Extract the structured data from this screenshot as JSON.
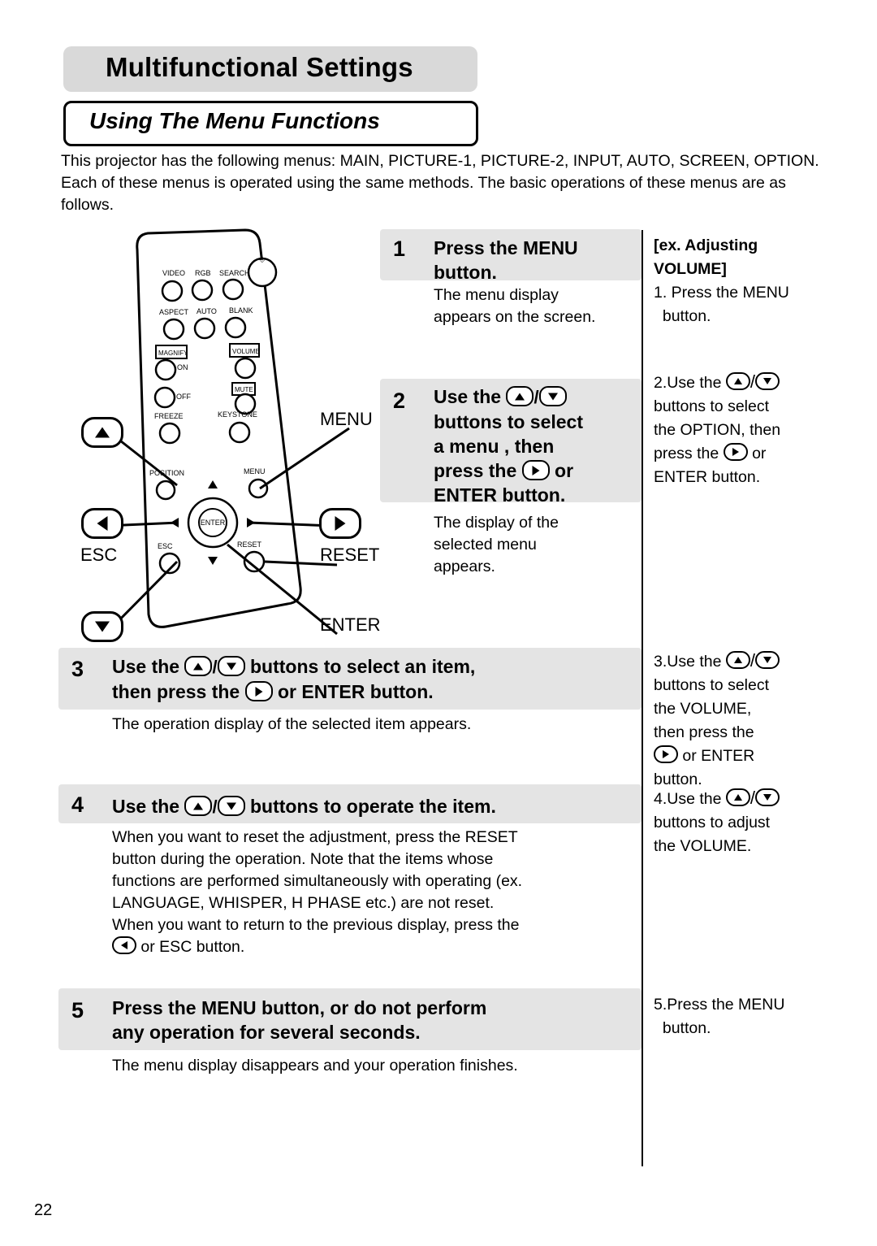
{
  "header": {
    "title": "Multifunctional Settings",
    "subtitle": "Using The Menu Functions"
  },
  "intro": "This projector has the following menus: MAIN, PICTURE-1, PICTURE-2, INPUT, AUTO, SCREEN, OPTION. Each of these menus is operated using the same methods. The basic operations of these menus are as follows.",
  "remote": {
    "buttons": [
      "VIDEO",
      "RGB",
      "SEARCH",
      "ASPECT",
      "AUTO",
      "BLANK",
      "MAGNIFY",
      "ON",
      "OFF",
      "VOLUME",
      "MUTE",
      "FREEZE",
      "KEYSTONE",
      "POSITION",
      "MENU",
      "ENTER",
      "ESC",
      "RESET"
    ],
    "callouts": {
      "menu": "MENU",
      "esc": "ESC",
      "reset": "RESET",
      "enter": "ENTER"
    }
  },
  "steps": [
    {
      "number": "1",
      "head_line1": "Press the MENU",
      "head_line2": "button.",
      "body_line1": "The menu display",
      "body_line2": "appears on the screen."
    },
    {
      "number": "2",
      "head_part1": "Use the",
      "head_part2": "buttons to select",
      "head_part3": "a menu , then",
      "head_part4": "press the",
      "head_part5": "or",
      "head_part6": "ENTER button.",
      "body_line1": "The display of the",
      "body_line2": "selected menu",
      "body_line3": "appears."
    },
    {
      "number": "3",
      "head_part1": "Use the",
      "head_part2": "buttons  to  select  an  item,",
      "head_part3": "then press the",
      "head_part4": "or ENTER button.",
      "body_line1": "The operation display of the selected item appears."
    },
    {
      "number": "4",
      "head_part1": "Use the",
      "head_part2": "buttons to operate the item.",
      "body_line1": "When you want to reset the adjustment, press the RESET",
      "body_line2": "button during the operation. Note that the items whose",
      "body_line3": "functions are performed simultaneously with operating (ex.",
      "body_line4": "LANGUAGE, WHISPER, H PHASE etc.) are not reset.",
      "body_line5": "When you want to return to the previous display, press the",
      "body_line6": "or ESC button."
    },
    {
      "number": "5",
      "head_part1": "Press  the  MENU  button,  or  do  not  perform",
      "head_part2": "any operation for several seconds.",
      "body_line1": "The menu display disappears and your operation finishes."
    }
  ],
  "example": {
    "title_line1": "[ex. Adjusting",
    "title_line2": "VOLUME]",
    "item1_line1": "1. Press the MENU",
    "item1_line2": "button.",
    "item2_prefix": "2.Use the",
    "item2_line2": "buttons to select",
    "item2_line3": "the OPTION, then",
    "item2_line4_a": "press the",
    "item2_line4_b": "or",
    "item2_line5": "ENTER button.",
    "item3_prefix": "3.Use the",
    "item3_line2": "buttons to select",
    "item3_line3": "the VOLUME,",
    "item3_line4": "then press the",
    "item3_line5": "or ENTER",
    "item3_line6": "button.",
    "item4_prefix": "4.Use the",
    "item4_line2": "buttons to adjust",
    "item4_line3": "the VOLUME.",
    "item5_line1": "5.Press the MENU",
    "item5_line2": "button."
  },
  "page_number": "22"
}
